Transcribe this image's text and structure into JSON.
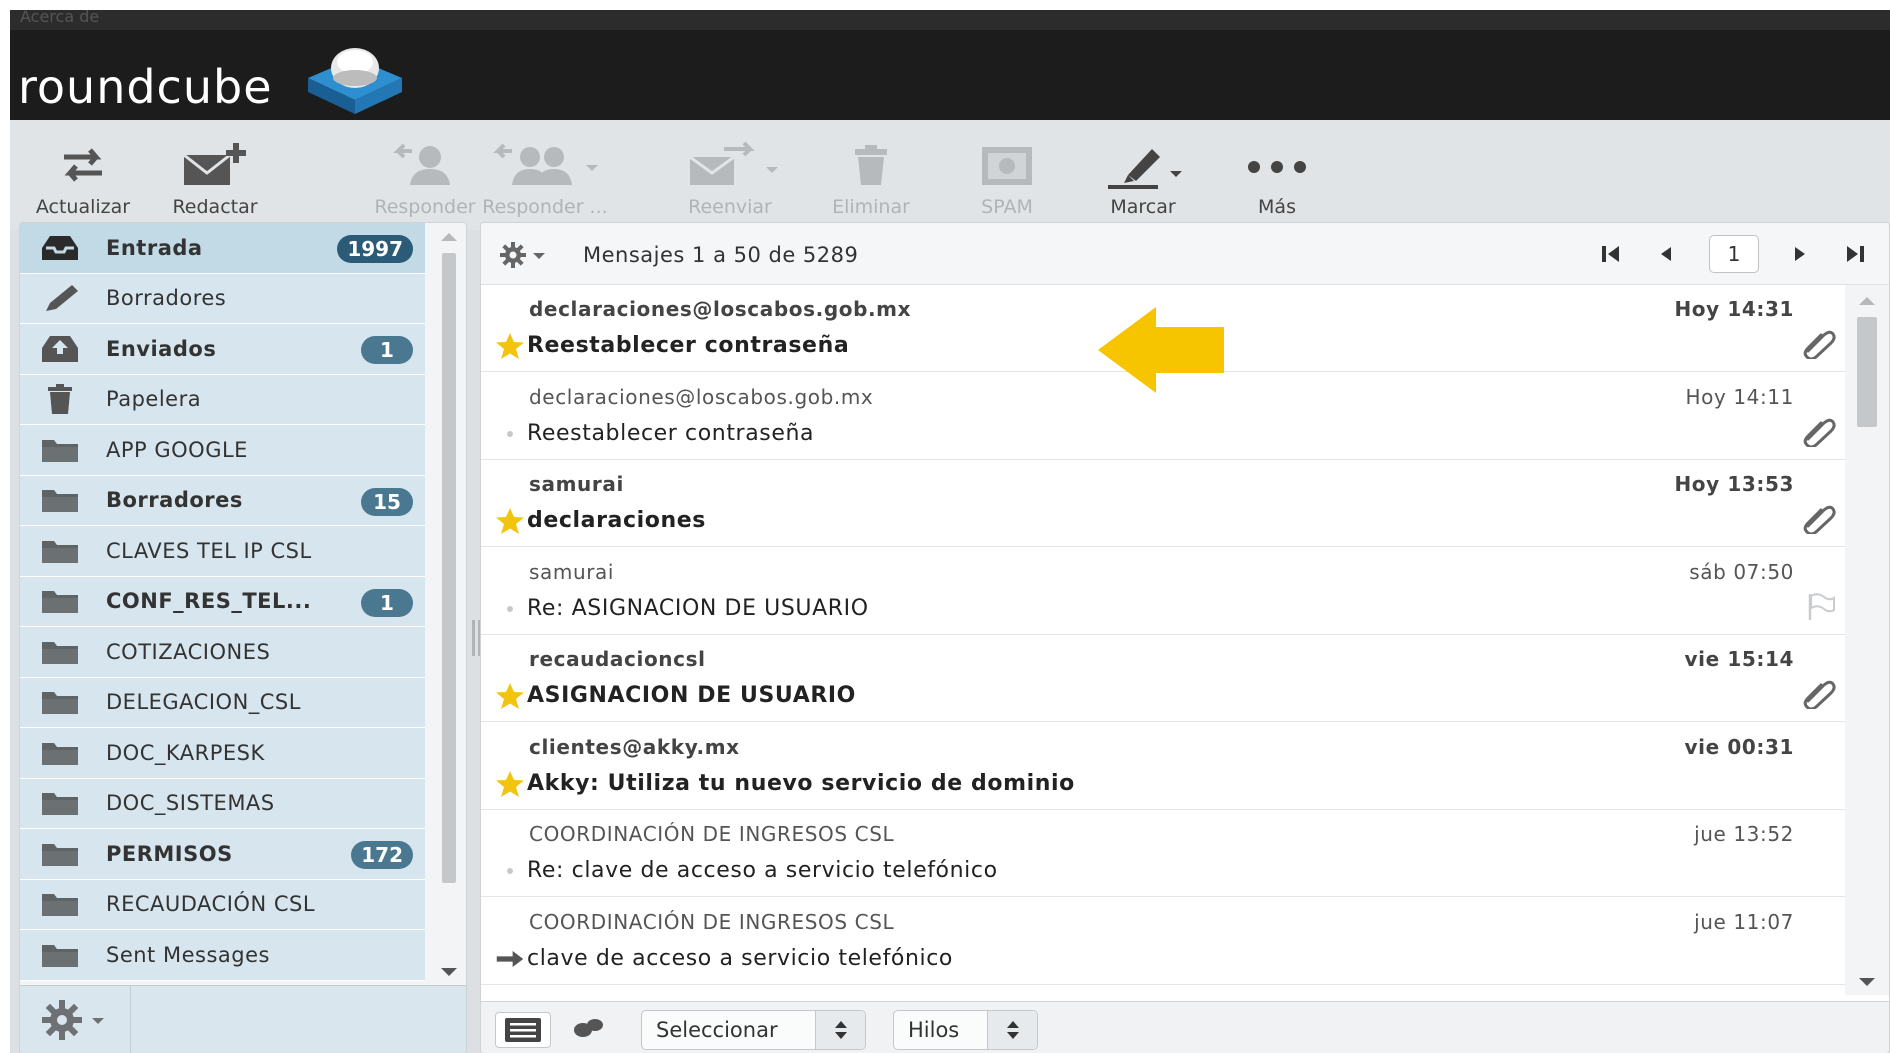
{
  "window": {
    "top_text": "Acerca de"
  },
  "brand": {
    "logo_text": "roundcube"
  },
  "toolbar": {
    "buttons": [
      {
        "label": "Actualizar",
        "icon": "refresh-icon",
        "enabled": true
      },
      {
        "label": "Redactar",
        "icon": "compose-icon",
        "enabled": true
      },
      {
        "label": "Responder",
        "icon": "reply-icon",
        "enabled": false
      },
      {
        "label": "Responder ...",
        "icon": "reply-all-icon",
        "enabled": false
      },
      {
        "label": "Reenviar",
        "icon": "forward-icon",
        "enabled": false
      },
      {
        "label": "Eliminar",
        "icon": "trash-icon",
        "enabled": false
      },
      {
        "label": "SPAM",
        "icon": "spam-icon",
        "enabled": false
      },
      {
        "label": "Marcar",
        "icon": "mark-icon",
        "enabled": true
      },
      {
        "label": "Más",
        "icon": "more-icon",
        "enabled": true
      }
    ]
  },
  "folders": [
    {
      "name": "Entrada",
      "icon": "inbox-icon",
      "bold": true,
      "selected": true,
      "badge": "1997",
      "badge_style": "dark"
    },
    {
      "name": "Borradores",
      "icon": "pencil-icon",
      "bold": false,
      "badge": ""
    },
    {
      "name": "Enviados",
      "icon": "sent-icon",
      "bold": true,
      "badge": "1"
    },
    {
      "name": "Papelera",
      "icon": "trash-icon",
      "bold": false,
      "badge": ""
    },
    {
      "name": "APP GOOGLE",
      "icon": "folder-icon",
      "bold": false,
      "badge": ""
    },
    {
      "name": "Borradores",
      "icon": "folder-icon",
      "bold": true,
      "badge": "15"
    },
    {
      "name": "CLAVES TEL IP CSL",
      "icon": "folder-icon",
      "bold": false,
      "badge": ""
    },
    {
      "name": "CONF_RES_TEL...",
      "icon": "folder-icon",
      "bold": true,
      "badge": "1"
    },
    {
      "name": "COTIZACIONES",
      "icon": "folder-icon",
      "bold": false,
      "badge": ""
    },
    {
      "name": "DELEGACION_CSL",
      "icon": "folder-icon",
      "bold": false,
      "badge": ""
    },
    {
      "name": "DOC_KARPESK",
      "icon": "folder-icon",
      "bold": false,
      "badge": ""
    },
    {
      "name": "DOC_SISTEMAS",
      "icon": "folder-icon",
      "bold": false,
      "badge": ""
    },
    {
      "name": "PERMISOS",
      "icon": "folder-icon",
      "bold": true,
      "badge": "172"
    },
    {
      "name": "RECAUDACIÓN CSL",
      "icon": "folder-icon",
      "bold": false,
      "badge": ""
    },
    {
      "name": "Sent Messages",
      "icon": "folder-icon",
      "bold": false,
      "badge": ""
    }
  ],
  "messagelist": {
    "count_text": "Mensajes 1 a 50 de 5289",
    "page": "1",
    "messages": [
      {
        "from": "declaraciones@loscabos.gob.mx",
        "date": "Hoy 14:31",
        "subject": "Reestablecer contraseña",
        "unread": true,
        "status": "star",
        "attachment": true
      },
      {
        "from": "declaraciones@loscabos.gob.mx",
        "date": "Hoy 14:11",
        "subject": "Reestablecer contraseña",
        "unread": false,
        "status": "dot",
        "attachment": true
      },
      {
        "from": "samurai",
        "date": "Hoy 13:53",
        "subject": "declaraciones",
        "unread": true,
        "status": "star",
        "attachment": true
      },
      {
        "from": "samurai",
        "date": "sáb 07:50",
        "subject": "Re: ASIGNACION DE USUARIO",
        "unread": false,
        "status": "dot",
        "attachment": false,
        "flag": true
      },
      {
        "from": "recaudacioncsl",
        "date": "vie 15:14",
        "subject": "ASIGNACION DE USUARIO",
        "unread": true,
        "status": "star",
        "attachment": true
      },
      {
        "from": "clientes@akky.mx",
        "date": "vie 00:31",
        "subject": "Akky: Utiliza tu nuevo servicio de dominio",
        "unread": true,
        "status": "star",
        "attachment": false
      },
      {
        "from": "COORDINACIÓN DE INGRESOS CSL",
        "date": "jue 13:52",
        "subject": "Re: clave de acceso a servicio telefónico",
        "unread": false,
        "status": "dot",
        "attachment": false
      },
      {
        "from": "COORDINACIÓN DE INGRESOS CSL",
        "date": "jue 11:07",
        "subject": "clave de acceso a servicio telefónico",
        "unread": false,
        "status": "forwarded",
        "attachment": false
      }
    ]
  },
  "footer": {
    "select_label": "Seleccionar",
    "threads_label": "Hilos"
  },
  "colors": {
    "header_bg": "#1c1c1c",
    "folder_bg": "#d6e5ee",
    "badge_bg": "#4b7891",
    "star": "#f2c40f",
    "annotation_arrow": "#f7c400"
  }
}
